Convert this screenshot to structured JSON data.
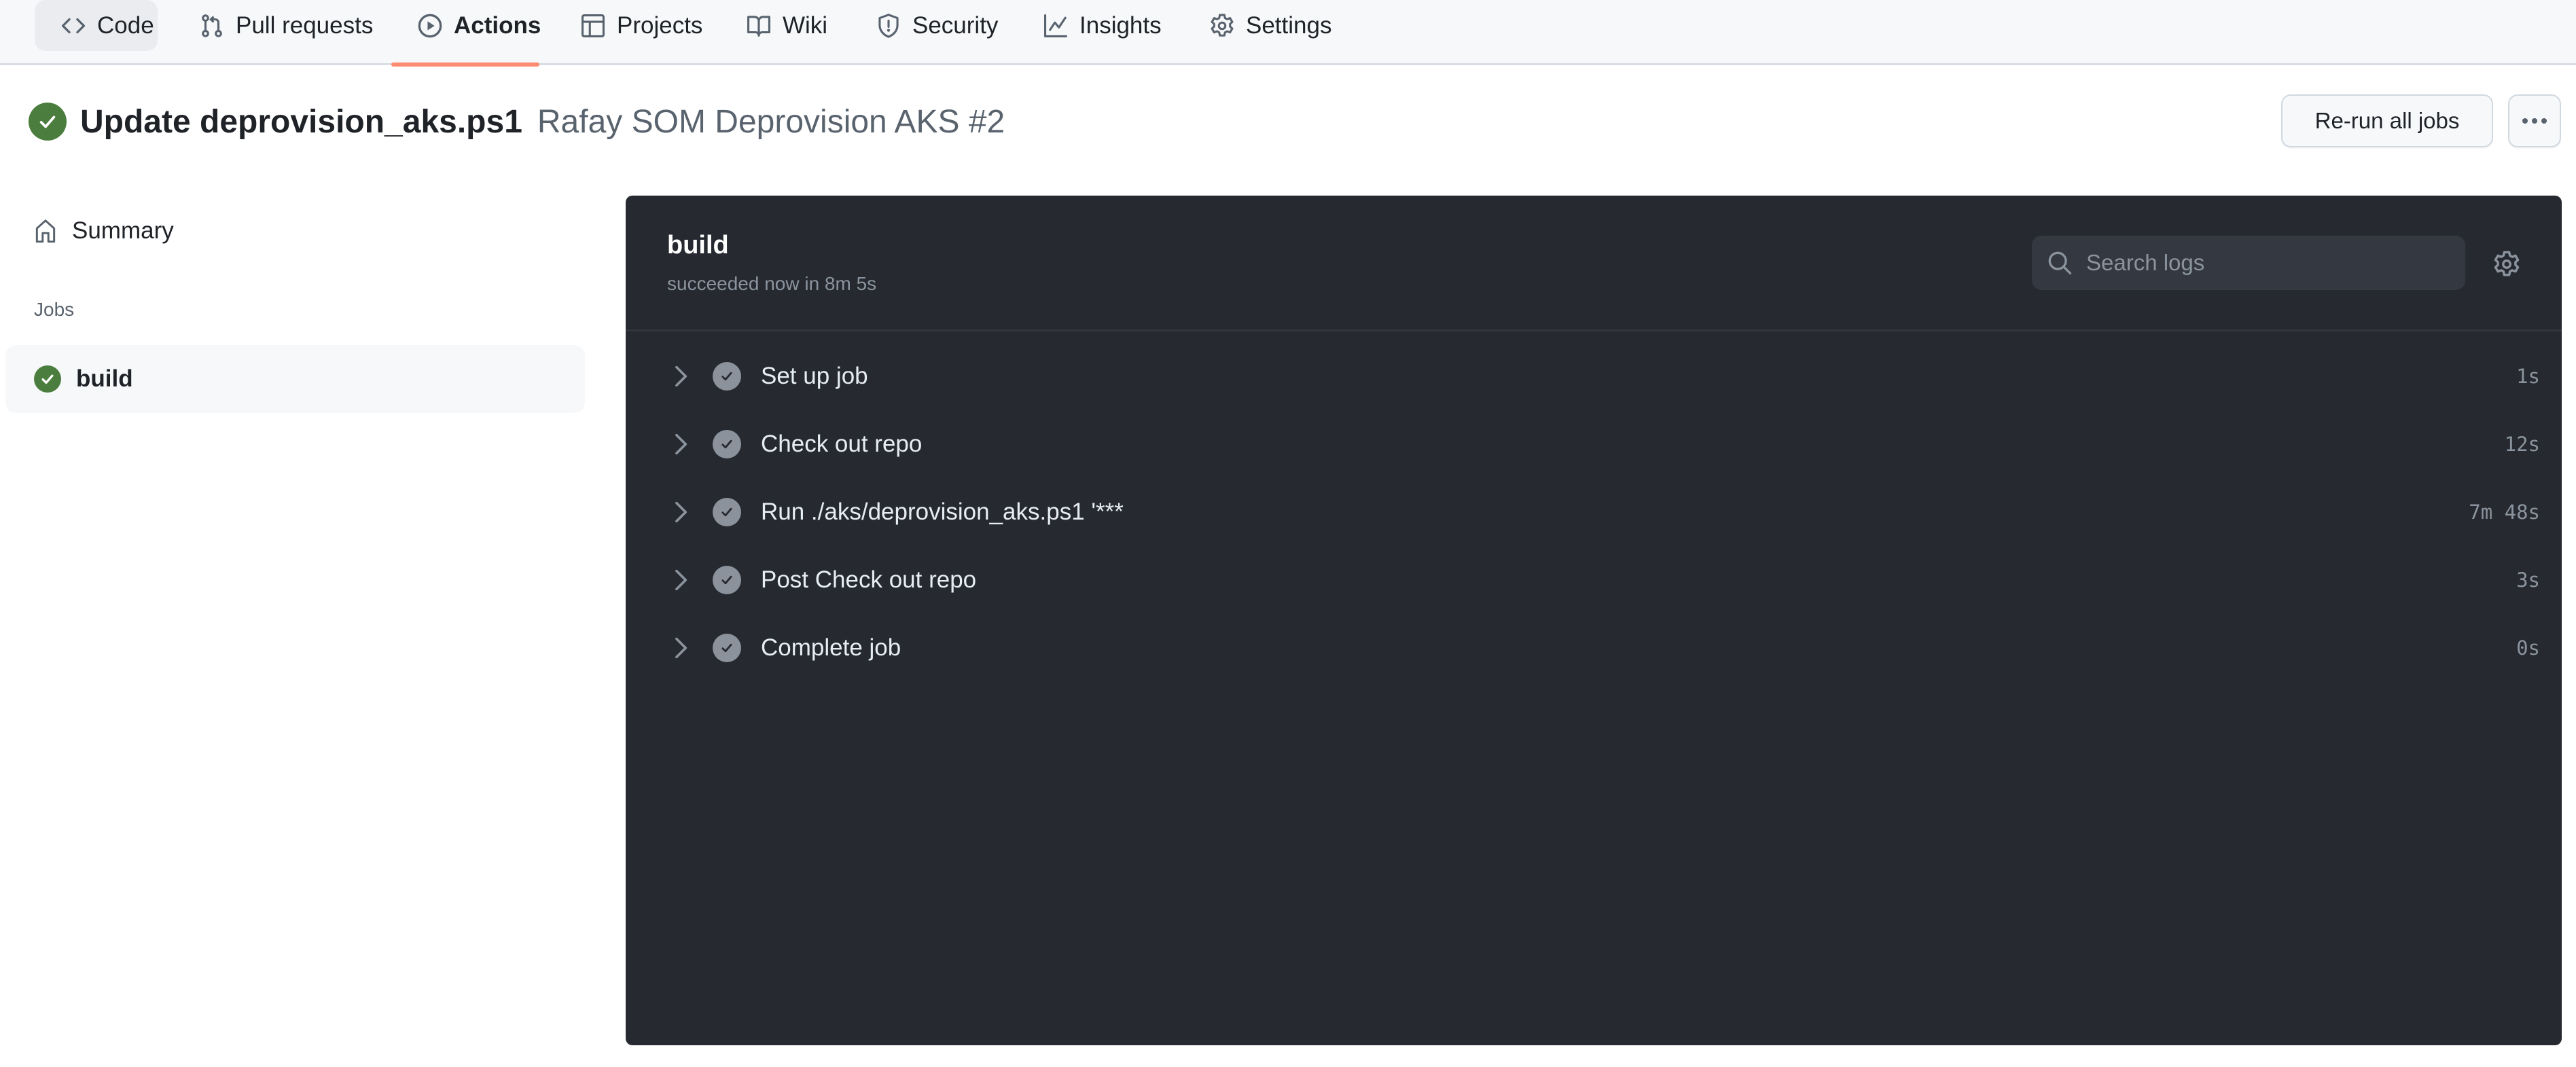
{
  "nav": {
    "tabs": [
      {
        "label": "Code",
        "icon": "code-icon"
      },
      {
        "label": "Pull requests",
        "icon": "git-pull-request-icon"
      },
      {
        "label": "Actions",
        "icon": "play-icon"
      },
      {
        "label": "Projects",
        "icon": "table-icon"
      },
      {
        "label": "Wiki",
        "icon": "book-icon"
      },
      {
        "label": "Security",
        "icon": "shield-icon"
      },
      {
        "label": "Insights",
        "icon": "graph-icon"
      },
      {
        "label": "Settings",
        "icon": "gear-icon"
      }
    ],
    "active_tab": "Actions",
    "accent_color": "#fd8c73"
  },
  "run": {
    "status": "success",
    "status_color": "#4b7d3e",
    "commit_title": "Update deprovision_aks.ps1",
    "workflow_name": "Rafay SOM Deprovision AKS #2",
    "rerun_label": "Re-run all jobs",
    "more_label": "More options"
  },
  "sidebar": {
    "summary_label": "Summary",
    "jobs_heading": "Jobs",
    "jobs": [
      {
        "name": "build",
        "status": "success"
      }
    ]
  },
  "job": {
    "name": "build",
    "status_text": "succeeded now in 8m 5s",
    "search_placeholder": "Search logs",
    "steps": [
      {
        "label": "Set up job",
        "duration": "1s",
        "status": "success"
      },
      {
        "label": "Check out repo",
        "duration": "12s",
        "status": "success"
      },
      {
        "label": "Run ./aks/deprovision_aks.ps1 '***",
        "duration": "7m 48s",
        "status": "success"
      },
      {
        "label": "Post Check out repo",
        "duration": "3s",
        "status": "success"
      },
      {
        "label": "Complete job",
        "duration": "0s",
        "status": "success"
      }
    ]
  }
}
